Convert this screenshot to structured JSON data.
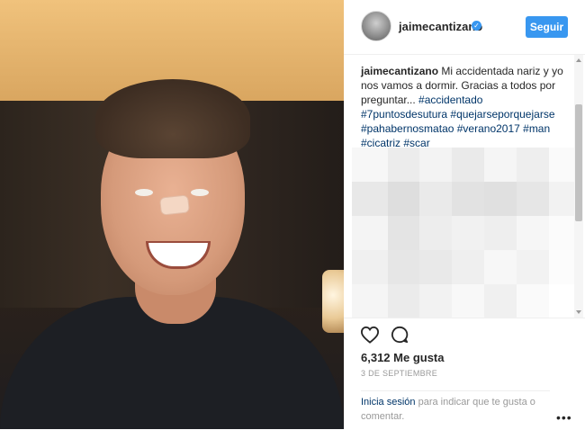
{
  "post": {
    "username": "jaimecantizano",
    "follow_label": "Seguir",
    "caption": {
      "user": "jaimecantizano",
      "text": "Mi accidentada nariz y yo nos vamos a dormir. Gracias a todos por preguntar... ",
      "hashtags": "#accidentado #7puntosdesutura #quejarseporquejarse #pahabernosmatao #verano2017 #man #cicatriz #scar"
    },
    "likes": "6,312 Me gusta",
    "date": "3 DE SEPTIEMBRE",
    "login": {
      "link": "Inicia sesión",
      "text": " para indicar que te gusta o comentar."
    },
    "more_label": "•••"
  },
  "icons": {
    "avatar": "profile-picture",
    "verified": "verified-badge-icon",
    "like": "heart-icon",
    "comment": "comment-bubble-icon",
    "more": "ellipsis-icon"
  },
  "colors": {
    "accent": "#3897f0",
    "hashtag": "#003569",
    "text": "#262626",
    "muted": "#999999"
  }
}
